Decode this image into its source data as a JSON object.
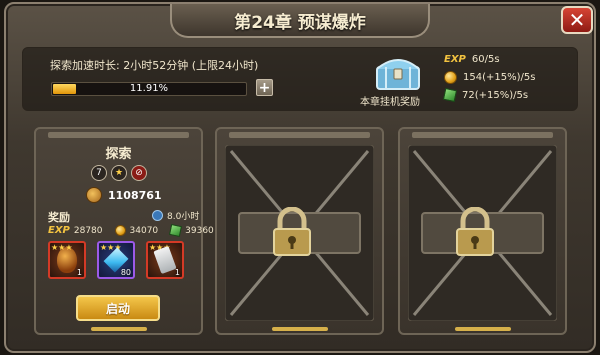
{
  "title": "第24章 预谋爆炸",
  "close_label": "✕",
  "speed": {
    "label": "探索加速时长: 2小时52分钟 (上限24小时)",
    "progress_text": "11.91%",
    "progress_fraction": 0.1191,
    "plus_label": "+"
  },
  "chest_label": "本章挂机奖励",
  "rates": {
    "exp_tag": "EXP",
    "exp": "60/5s",
    "gold": "154(+15%)/5s",
    "gem": "72(+15%)/5s"
  },
  "explore_slot": {
    "title": "探索",
    "badges": [
      "7",
      "★",
      "⊘"
    ],
    "power": "1108761",
    "reward_label": "奖励",
    "time": "8.0小时",
    "exp_tag": "EXP",
    "exp": "28780",
    "gold": "34070",
    "gem": "39360",
    "items": [
      {
        "stars": "★★★",
        "count": "1"
      },
      {
        "stars": "★★★",
        "count": "80"
      },
      {
        "stars": "★★★",
        "count": "1"
      }
    ],
    "start_label": "启动"
  },
  "colors": {
    "accent_gold": "#f3c340",
    "close_red": "#c5372a",
    "rarity_red": "#d43a26",
    "rarity_purple": "#9c5ae8"
  }
}
